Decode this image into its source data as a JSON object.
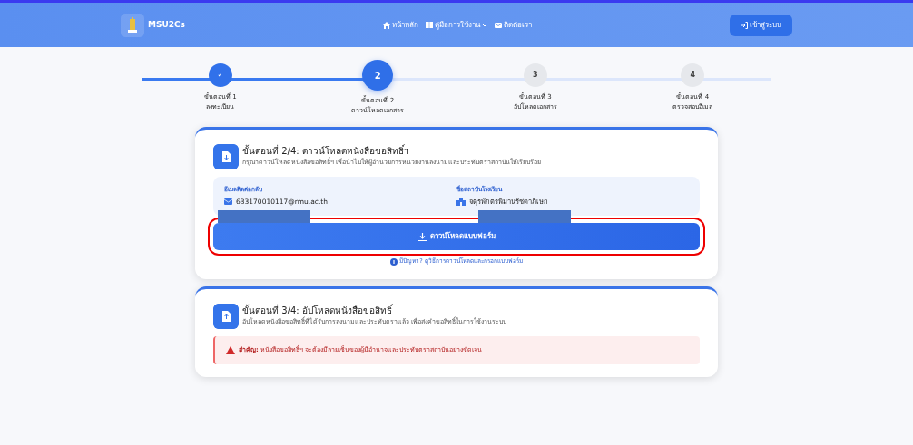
{
  "navbar": {
    "brand": "MSU2Cs",
    "links": [
      {
        "label": "หน้าหลัก",
        "dropdown": false
      },
      {
        "label": "คู่มือการใช้งาน",
        "dropdown": true
      },
      {
        "label": "ติดต่อเรา",
        "dropdown": false
      }
    ],
    "login_button": "เข้าสู่ระบบ"
  },
  "steps": [
    {
      "marker": "✓",
      "title": "ขั้นตอนที่ 1",
      "label": "ลงทะเบียน",
      "completed": true,
      "selected": false
    },
    {
      "marker": "2",
      "title": "ขั้นตอนที่ 2",
      "label": "ดาวน์โหลดเอกสาร",
      "completed": false,
      "selected": true
    },
    {
      "marker": "3",
      "title": "ขั้นตอนที่ 3",
      "label": "อัปโหลดเอกสาร",
      "completed": false,
      "selected": false
    },
    {
      "marker": "4",
      "title": "ขั้นตอนที่ 4",
      "label": "ตรวจสอบอีเมล",
      "completed": false,
      "selected": false
    }
  ],
  "download_card": {
    "title": "ขั้นตอนที่ 2/4: ดาวน์โหลดหนังสือขอสิทธิ์ฯ",
    "subtitle": "กรุณาดาวน์โหลดหนังสือขอสิทธิ์ฯ เพื่อนำไปให้ผู้อำนวยการหน่วยงานลงนามและประทับตราสถาบันให้เรียบร้อย",
    "info": [
      {
        "label": "อีเมลติดต่อกลับ",
        "value": "633170010117@rmu.ac.th",
        "kind": "email"
      },
      {
        "label": "ชื่อสถาบันโรงเรียน",
        "value": "จตุรพักตรพิมานรัชดาภิเษก",
        "kind": "school"
      }
    ],
    "button": "ดาวน์โหลดแบบฟอร์ม",
    "help_link": "มีปัญหา? ดูวิธีการดาวน์โหลดและกรอกแบบฟอร์ม"
  },
  "upload_card": {
    "title": "ขั้นตอนที่ 3/4: อัปโหลดหนังสือขอสิทธิ์",
    "subtitle": "อัปโหลดหนังสือขอสิทธิ์ที่ได้รับการลงนามและประทับตราแล้ว เพื่อส่งคำขอสิทธิ์ในการใช้งานระบบ",
    "alert": "**สำคัญ:** หนังสือขอสิทธิ์ฯ จะต้องมีลายเซ็นของผู้มีอำนาจและประทับตราสถาบันอย่างชัดเจน"
  }
}
